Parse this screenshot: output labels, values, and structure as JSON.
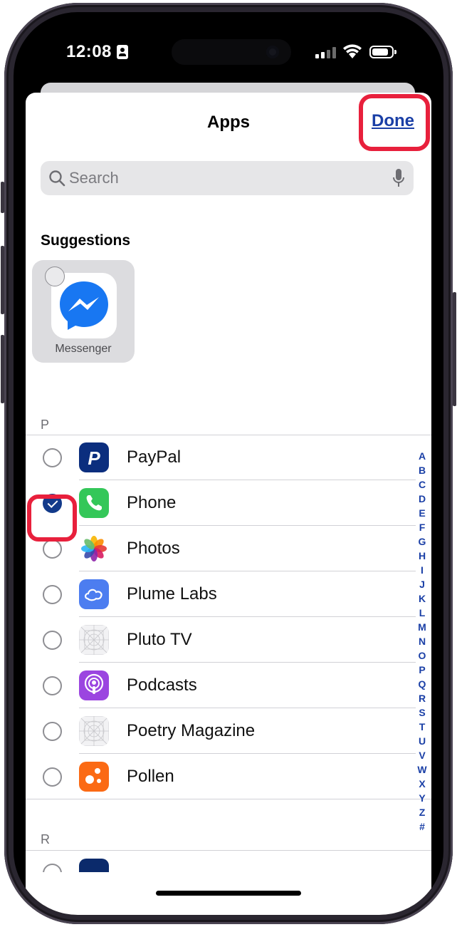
{
  "status_bar": {
    "time": "12:08"
  },
  "sheet": {
    "title": "Apps",
    "done_label": "Done"
  },
  "search": {
    "placeholder": "Search",
    "value": ""
  },
  "suggestions": {
    "heading": "Suggestions",
    "items": [
      {
        "label": "Messenger",
        "selected": false
      }
    ]
  },
  "sections": [
    {
      "letter": "P",
      "apps": [
        {
          "name": "PayPal",
          "selected": false,
          "icon": "paypal-icon"
        },
        {
          "name": "Phone",
          "selected": true,
          "icon": "phone-icon"
        },
        {
          "name": "Photos",
          "selected": false,
          "icon": "photos-icon"
        },
        {
          "name": "Plume Labs",
          "selected": false,
          "icon": "plume-labs-icon"
        },
        {
          "name": "Pluto TV",
          "selected": false,
          "icon": "placeholder-app-icon"
        },
        {
          "name": "Podcasts",
          "selected": false,
          "icon": "podcasts-icon"
        },
        {
          "name": "Poetry Magazine",
          "selected": false,
          "icon": "placeholder-app-icon"
        },
        {
          "name": "Pollen",
          "selected": false,
          "icon": "pollen-icon"
        }
      ]
    },
    {
      "letter": "R",
      "apps": []
    }
  ],
  "index_letters": [
    "A",
    "B",
    "C",
    "D",
    "E",
    "F",
    "G",
    "H",
    "I",
    "J",
    "K",
    "L",
    "M",
    "N",
    "O",
    "P",
    "Q",
    "R",
    "S",
    "T",
    "U",
    "V",
    "W",
    "X",
    "Y",
    "Z",
    "#"
  ],
  "colors": {
    "accent": "#1a3fa6",
    "highlight": "#e8203c",
    "checked": "#123a8a",
    "frame": "#2a2630"
  }
}
